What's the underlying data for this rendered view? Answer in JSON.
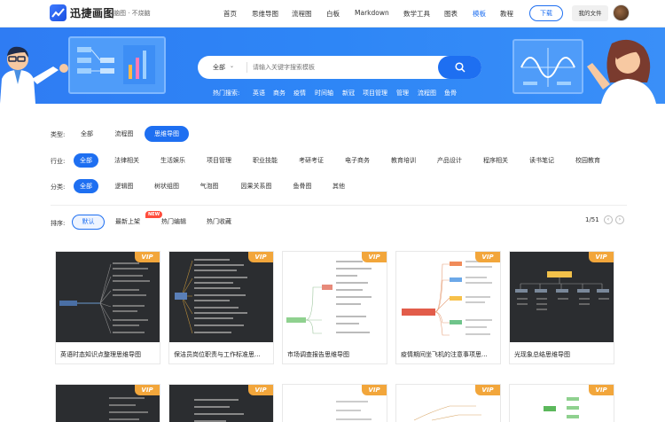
{
  "brand": {
    "name": "迅捷画图",
    "slogan": "脑图 · 不烧脑"
  },
  "nav": {
    "items": [
      {
        "label": "首页",
        "active": false
      },
      {
        "label": "思维导图",
        "active": false
      },
      {
        "label": "流程图",
        "active": false
      },
      {
        "label": "白板",
        "active": false
      },
      {
        "label": "Markdown",
        "active": false
      },
      {
        "label": "数学工具",
        "active": false
      },
      {
        "label": "图表",
        "active": false
      },
      {
        "label": "模板",
        "active": true
      },
      {
        "label": "教程",
        "active": false
      }
    ],
    "download": "下载",
    "my_files": "我的文件"
  },
  "search": {
    "scope": "全部",
    "placeholder": "请输入关键字搜索模板",
    "hot_label": "热门搜索:",
    "hot_keywords": [
      "英语",
      "商务",
      "疫情",
      "时间轴",
      "新冠",
      "项目管理",
      "管理",
      "流程图",
      "鱼骨"
    ]
  },
  "filters": {
    "type": {
      "label": "类型:",
      "options": [
        "全部",
        "流程图",
        "思维导图"
      ],
      "active": 2
    },
    "industry": {
      "label": "行业:",
      "options": [
        "全部",
        "法律相关",
        "生活娱乐",
        "项目管理",
        "职业技能",
        "考研考证",
        "电子商务",
        "教育培训",
        "产品设计",
        "程序相关",
        "读书笔记",
        "校园教育"
      ],
      "active": 0
    },
    "category": {
      "label": "分类:",
      "options": [
        "全部",
        "逻辑图",
        "树状组图",
        "气泡图",
        "因果关系图",
        "鱼骨图",
        "其他"
      ],
      "active": 0
    }
  },
  "sort": {
    "label": "排序:",
    "options": [
      "默认",
      "最新上架",
      "热门编辑",
      "热门收藏"
    ],
    "active": 0,
    "new_badge": "NEW",
    "pager": "1/51"
  },
  "cards": [
    {
      "title": "英语时态知识点整理思维导图",
      "vip": "VIP",
      "theme": "dark"
    },
    {
      "title": "保洁员岗位职责与工作标准思...",
      "vip": "VIP",
      "theme": "dark"
    },
    {
      "title": "市场调查报告思维导图",
      "vip": "VIP",
      "theme": "light"
    },
    {
      "title": "疫情期间坐飞机的注意事项思...",
      "vip": "VIP",
      "theme": "light"
    },
    {
      "title": "光现象总结思维导图",
      "vip": "VIP",
      "theme": "dark"
    }
  ],
  "cards_row2": [
    {
      "vip": "VIP",
      "theme": "dark"
    },
    {
      "vip": "VIP",
      "theme": "dark"
    },
    {
      "vip": "VIP",
      "theme": "light"
    },
    {
      "vip": "VIP",
      "theme": "light"
    },
    {
      "vip": "VIP",
      "theme": "light"
    }
  ],
  "colors": {
    "accent": "#1e6ff1",
    "banner": "#2f7cf3",
    "vip": "#f2a63b",
    "new_badge": "#ff4d3c"
  }
}
